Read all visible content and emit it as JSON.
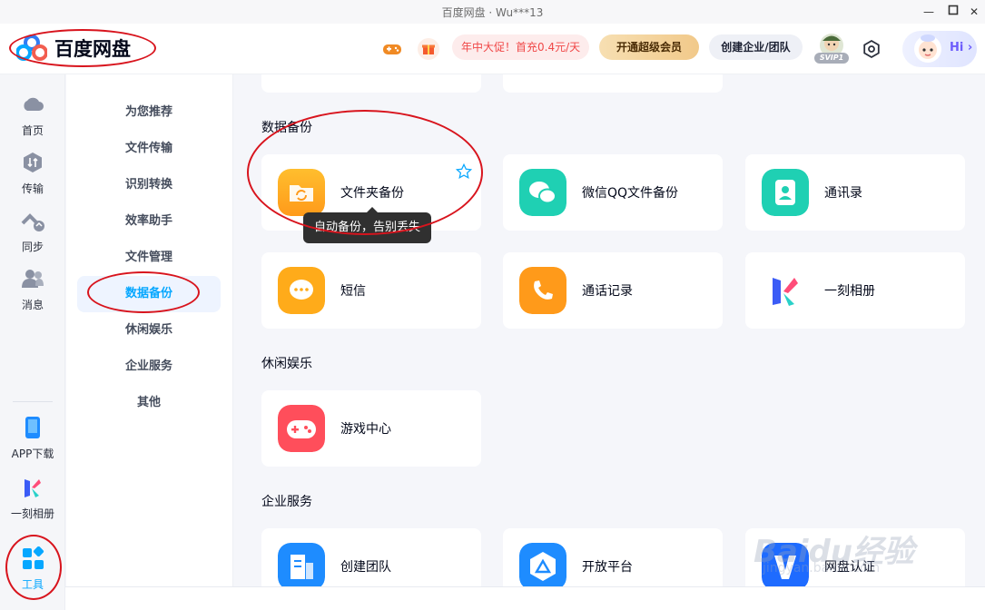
{
  "window": {
    "title": "百度网盘 · Wu***13"
  },
  "header": {
    "logo_text": "百度网盘",
    "promo_text": "年中大促！首充0.4元/天",
    "vip_button": "开通超级会员",
    "team_button": "创建企业/团队",
    "svip_label": "SVIP1",
    "hi_text": "Hi ›"
  },
  "rail": {
    "items": [
      {
        "label": "首页",
        "icon": "cloud-icon"
      },
      {
        "label": "传输",
        "icon": "transfer-icon"
      },
      {
        "label": "同步",
        "icon": "sync-icon"
      },
      {
        "label": "消息",
        "icon": "message-icon"
      },
      {
        "label": "APP下载",
        "icon": "phone-icon"
      },
      {
        "label": "一刻相册",
        "icon": "album-icon"
      },
      {
        "label": "工具",
        "icon": "tools-icon"
      }
    ]
  },
  "categories": {
    "items": [
      "为您推荐",
      "文件传输",
      "识别转换",
      "效率助手",
      "文件管理",
      "数据备份",
      "休闲娱乐",
      "企业服务",
      "其他"
    ],
    "active": "数据备份"
  },
  "sections": {
    "backup": {
      "title": "数据备份",
      "cards": [
        "文件夹备份",
        "微信QQ文件备份",
        "通讯录",
        "短信",
        "通话记录",
        "一刻相册"
      ],
      "tooltip": "自动备份，告别丢失"
    },
    "leisure": {
      "title": "休闲娱乐",
      "cards": [
        "游戏中心"
      ]
    },
    "enterprise": {
      "title": "企业服务",
      "cards": [
        "创建团队",
        "开放平台",
        "网盘认证"
      ]
    }
  },
  "watermark": {
    "main": "Baidu经验",
    "sub": "jingyan.baidu.com"
  },
  "colors": {
    "accent": "#06a7ff",
    "annotation": "#d8141d"
  }
}
